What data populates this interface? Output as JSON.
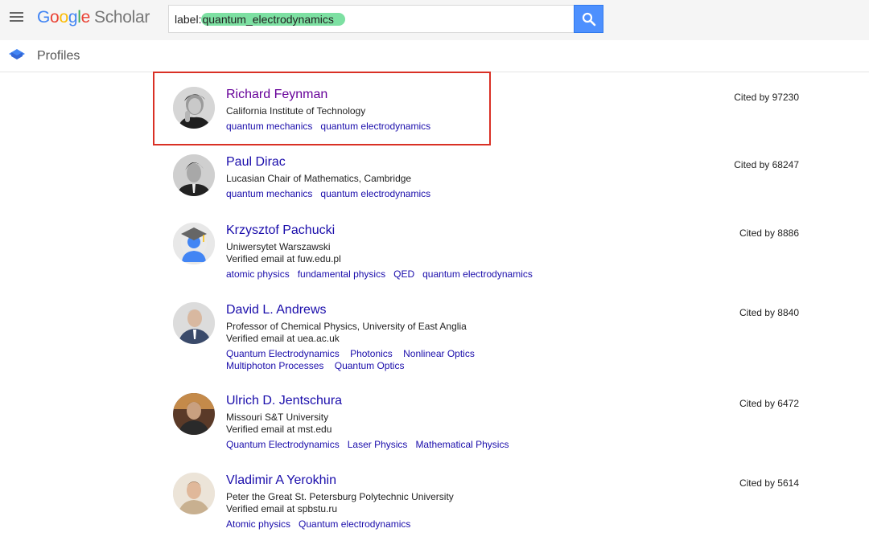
{
  "header": {
    "logo": {
      "g1": "G",
      "g2": "o",
      "g3": "o",
      "g4": "g",
      "g5": "l",
      "g6": "e",
      "scholar": "Scholar"
    },
    "search": {
      "prefix": "label:",
      "highlighted": "quantum_electrodynamics"
    }
  },
  "subheader": {
    "title": "Profiles"
  },
  "colors": {
    "accent": "#4d90fe",
    "link": "#1a0dab",
    "visited": "#660099",
    "highlight_box": "#d93025",
    "search_highlight": "#7de0a2"
  },
  "results": [
    {
      "name": "Richard Feynman",
      "affiliation": "California Institute of Technology",
      "email": "",
      "tags": [
        "quantum mechanics",
        "quantum electrodynamics"
      ],
      "cited": "Cited by 97230"
    },
    {
      "name": "Paul Dirac",
      "affiliation": "Lucasian Chair of Mathematics, Cambridge",
      "email": "",
      "tags": [
        "quantum mechanics",
        "quantum electrodynamics"
      ],
      "cited": "Cited by 68247"
    },
    {
      "name": "Krzysztof Pachucki",
      "affiliation": "Uniwersytet Warszawski",
      "email": "Verified email at fuw.edu.pl",
      "tags": [
        "atomic physics",
        "fundamental physics",
        "QED",
        "quantum electrodynamics"
      ],
      "cited": "Cited by 8886"
    },
    {
      "name": "David L. Andrews",
      "affiliation": "Professor of Chemical Physics, University of East Anglia",
      "email": "Verified email at uea.ac.uk",
      "tags": [
        "Quantum Electrodynamics",
        "Photonics",
        "Nonlinear Optics",
        "Multiphoton Processes",
        "Quantum Optics"
      ],
      "cited": "Cited by 8840"
    },
    {
      "name": "Ulrich D. Jentschura",
      "affiliation": "Missouri S&T University",
      "email": "Verified email at mst.edu",
      "tags": [
        "Quantum Electrodynamics",
        "Laser Physics",
        "Mathematical Physics"
      ],
      "cited": "Cited by 6472"
    },
    {
      "name": "Vladimir A Yerokhin",
      "affiliation": "Peter the Great St. Petersburg Polytechnic University",
      "email": "Verified email at spbstu.ru",
      "tags": [
        "Atomic physics",
        "Quantum electrodynamics"
      ],
      "cited": "Cited by 5614"
    }
  ]
}
